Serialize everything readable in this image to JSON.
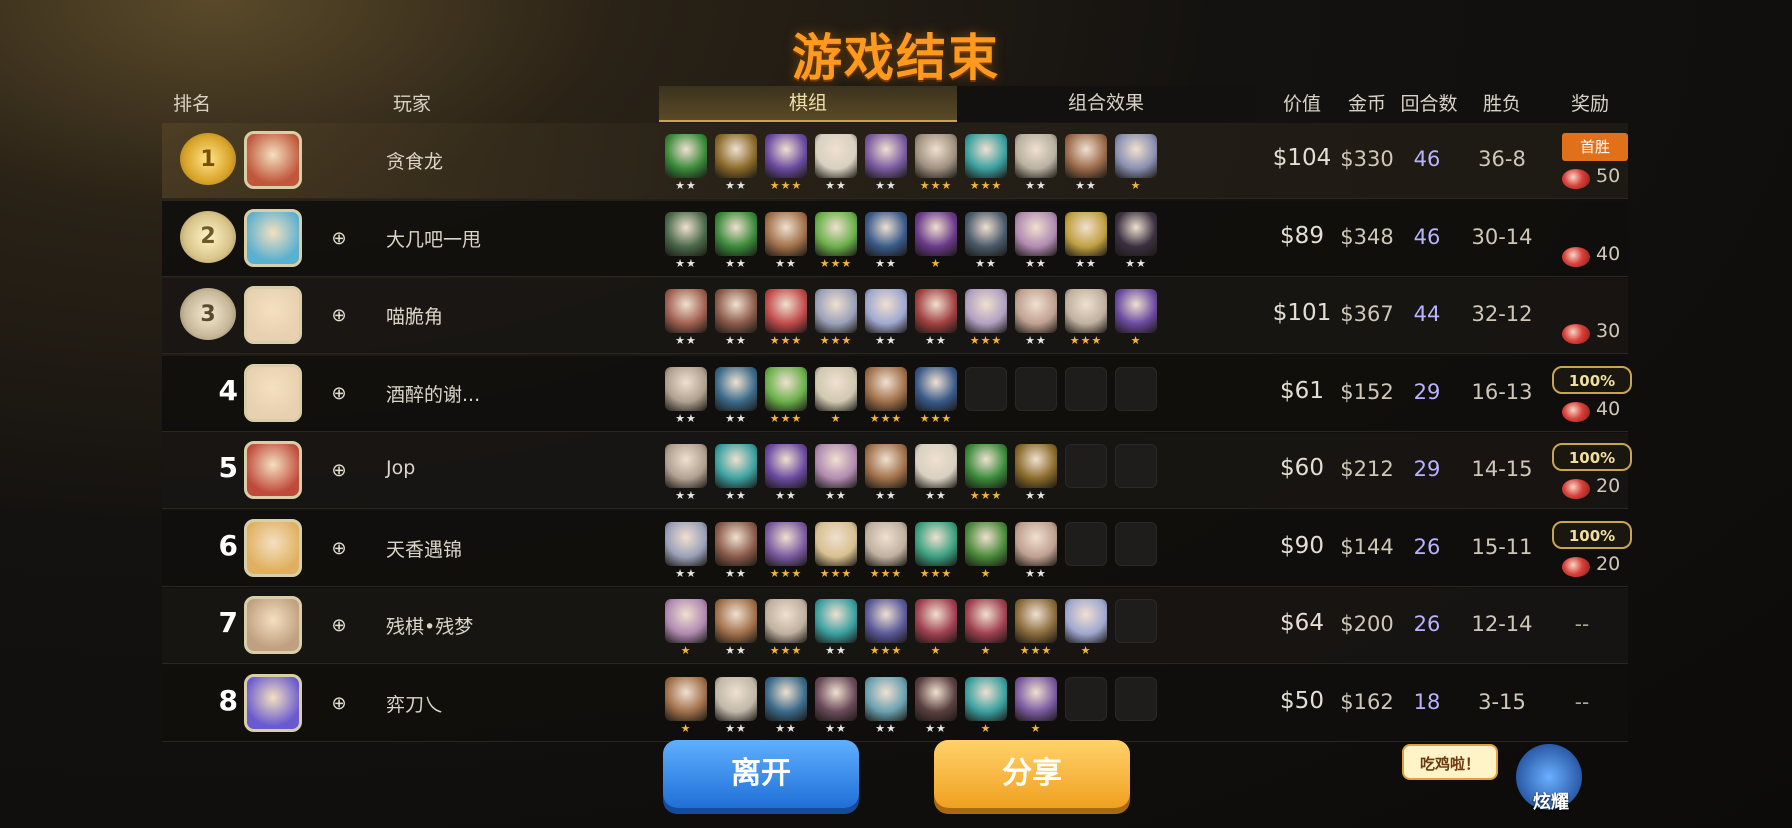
{
  "title": "游戏结束",
  "header": {
    "rank": "排名",
    "player": "玩家",
    "tab_pieces": "棋组",
    "tab_synergy": "组合效果",
    "value": "价值",
    "gold": "金币",
    "rounds": "回合数",
    "winloss": "胜负",
    "reward": "奖励"
  },
  "colors": {
    "title": "#ff9a1e",
    "rounds": "#b9b3ff",
    "star_gold": "#f2b43a",
    "star_silver": "#e6e6e6",
    "first_win": "#e0701a"
  },
  "rows": [
    {
      "rank": "1",
      "medal": "gold",
      "name": "贪食龙",
      "avatar": "#c0563a",
      "friend_icon": false,
      "pieces": [
        [
          "#3a8a3a",
          2
        ],
        [
          "#8a6a2a",
          2
        ],
        [
          "#6a4aa0",
          3
        ],
        [
          "#d8d0c0",
          2
        ],
        [
          "#7a5aa0",
          2
        ],
        [
          "#a09080",
          3
        ],
        [
          "#3aa0a0",
          3
        ],
        [
          "#b8b0a0",
          2
        ],
        [
          "#9a6a4a",
          2
        ],
        [
          "#8a90b0",
          1
        ]
      ],
      "value": "$104",
      "gold": "$330",
      "rounds": "46",
      "wl": "36-8",
      "reward": {
        "first_win": "首胜",
        "meat": "50"
      }
    },
    {
      "rank": "2",
      "medal": "silver",
      "name": "大几吧一甩",
      "avatar": "#5ab0d0",
      "friend_icon": true,
      "pieces": [
        [
          "#4a6a4a",
          2
        ],
        [
          "#3a8a3a",
          2
        ],
        [
          "#a0704a",
          2
        ],
        [
          "#6ab04a",
          3
        ],
        [
          "#3a5a8a",
          2
        ],
        [
          "#6a3a8a",
          1
        ],
        [
          "#4a5a6a",
          2
        ],
        [
          "#b08ab0",
          2
        ],
        [
          "#c0a040",
          2
        ],
        [
          "#3a3040",
          2
        ]
      ],
      "value": "$89",
      "gold": "$348",
      "rounds": "46",
      "wl": "30-14",
      "reward": {
        "meat": "40"
      }
    },
    {
      "rank": "3",
      "medal": "bronze",
      "name": "喵脆角",
      "avatar": "#e8d0b0",
      "friend_icon": true,
      "pieces": [
        [
          "#a06050",
          2
        ],
        [
          "#8a5a4a",
          2
        ],
        [
          "#c04a4a",
          3
        ],
        [
          "#9aa0b8",
          3
        ],
        [
          "#a0a8d0",
          2
        ],
        [
          "#a04040",
          2
        ],
        [
          "#b0a0c0",
          3
        ],
        [
          "#c0a090",
          2
        ],
        [
          "#c0b0a0",
          3
        ],
        [
          "#6a4aa0",
          1
        ]
      ],
      "value": "$101",
      "gold": "$367",
      "rounds": "44",
      "wl": "32-12",
      "reward": {
        "meat": "30"
      }
    },
    {
      "rank": "4",
      "name": "酒醉的谢...",
      "avatar": "#e8d0b0",
      "friend_icon": true,
      "pieces": [
        [
          "#b0a090",
          2
        ],
        [
          "#3a6a8a",
          2
        ],
        [
          "#6ab04a",
          3
        ],
        [
          "#d0c8b0",
          1
        ],
        [
          "#a0704a",
          3
        ],
        [
          "#3a5a8a",
          3
        ],
        null,
        null,
        null,
        null
      ],
      "value": "$61",
      "gold": "$152",
      "rounds": "29",
      "wl": "16-13",
      "reward": {
        "pct": "100%",
        "meat": "40"
      }
    },
    {
      "rank": "5",
      "name": "Jop",
      "avatar": "#c04a3a",
      "friend_icon": true,
      "pieces": [
        [
          "#b0a090",
          2
        ],
        [
          "#3aa0a0",
          2
        ],
        [
          "#6a4aa0",
          2
        ],
        [
          "#b08ab0",
          2
        ],
        [
          "#a0704a",
          2
        ],
        [
          "#d8d0c0",
          2
        ],
        [
          "#3a8a3a",
          3
        ],
        [
          "#8a6a2a",
          2
        ],
        null,
        null
      ],
      "value": "$60",
      "gold": "$212",
      "rounds": "29",
      "wl": "14-15",
      "reward": {
        "pct": "100%",
        "meat": "20"
      }
    },
    {
      "rank": "6",
      "name": "天香遇锦",
      "avatar": "#e0b060",
      "friend_icon": true,
      "pieces": [
        [
          "#9aa0b8",
          2
        ],
        [
          "#8a5a4a",
          2
        ],
        [
          "#7a5aa0",
          3
        ],
        [
          "#d8c090",
          3
        ],
        [
          "#c0b0a0",
          3
        ],
        [
          "#3aa080",
          3
        ],
        [
          "#4a8a3a",
          1
        ],
        [
          "#c0a090",
          2
        ],
        null,
        null
      ],
      "value": "$90",
      "gold": "$144",
      "rounds": "26",
      "wl": "15-11",
      "reward": {
        "pct": "100%",
        "meat": "20"
      }
    },
    {
      "rank": "7",
      "name": "残棋•残梦",
      "avatar": "#c0a080",
      "friend_icon": true,
      "pieces": [
        [
          "#b08ab0",
          1
        ],
        [
          "#a0704a",
          2
        ],
        [
          "#c0b0a0",
          3
        ],
        [
          "#3aa0a0",
          2
        ],
        [
          "#5a5a9a",
          3
        ],
        [
          "#a04050",
          1
        ],
        [
          "#a04050",
          1
        ],
        [
          "#8a6a3a",
          3
        ],
        [
          "#a0a8d0",
          1
        ],
        null
      ],
      "value": "$64",
      "gold": "$200",
      "rounds": "26",
      "wl": "12-14",
      "reward": {
        "dash": "--"
      }
    },
    {
      "rank": "8",
      "name": "弈刀乀",
      "avatar": "#6a5ad0",
      "friend_icon": true,
      "pieces": [
        [
          "#a0704a",
          1
        ],
        [
          "#c0b8a8",
          2
        ],
        [
          "#3a6a8a",
          2
        ],
        [
          "#6a4a5a",
          2
        ],
        [
          "#6aa0b0",
          2
        ],
        [
          "#5a4040",
          2
        ],
        [
          "#3aa0a0",
          1
        ],
        [
          "#7a5aa0",
          1
        ],
        null,
        null
      ],
      "value": "$50",
      "gold": "$162",
      "rounds": "18",
      "wl": "3-15",
      "reward": {
        "dash": "--"
      }
    }
  ],
  "buttons": {
    "leave": "离开",
    "share": "分享"
  },
  "brag": {
    "bubble": "吃鸡啦！",
    "label": "炫耀"
  }
}
